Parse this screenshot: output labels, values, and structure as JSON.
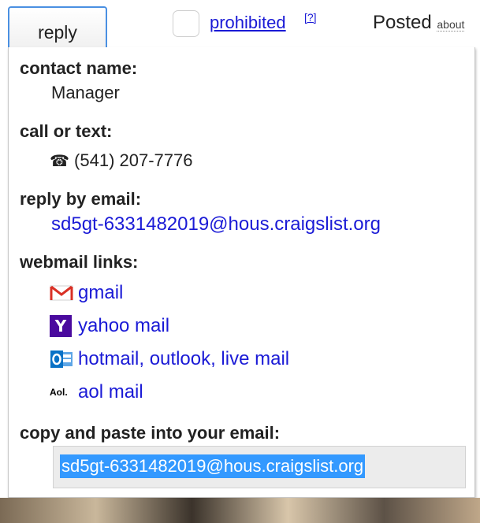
{
  "topbar": {
    "reply_label": "reply",
    "prohibited_label": "prohibited",
    "help_label": "[?]",
    "posted_label": "Posted",
    "posted_ago": "about"
  },
  "panel": {
    "contact": {
      "label": "contact name:",
      "value": "Manager"
    },
    "call": {
      "label": "call or text:",
      "phone_icon": "☎",
      "value": "(541) 207-7776"
    },
    "email": {
      "label": "reply by email:",
      "value": "sd5gt-6331482019@hous.craigslist.org"
    },
    "webmail": {
      "label": "webmail links:",
      "links": [
        {
          "icon": "gmail-icon",
          "label": "gmail"
        },
        {
          "icon": "yahoo-icon",
          "label": "yahoo mail"
        },
        {
          "icon": "outlook-icon",
          "label": "hotmail, outlook, live mail"
        },
        {
          "icon": "aol-icon",
          "label": "aol mail"
        }
      ]
    },
    "copy": {
      "label": "copy and paste into your email:",
      "value": "sd5gt-6331482019@hous.craigslist.org"
    }
  },
  "colors": {
    "link": "#1a1ad6",
    "selection": "#3399ff",
    "yahoo": "#4a0a9e",
    "outlook": "#0a72c6",
    "gmail": "#d93025"
  }
}
